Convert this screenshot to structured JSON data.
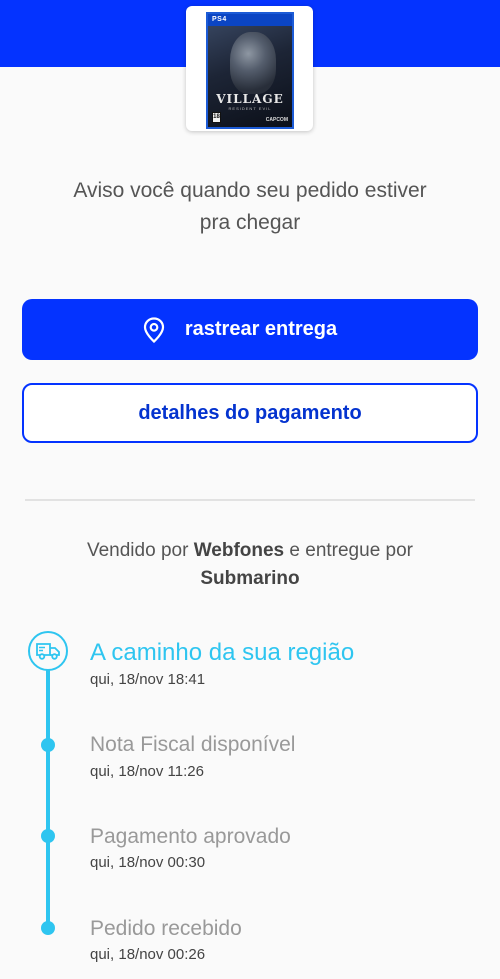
{
  "product": {
    "platform_label": "PS4",
    "game_logo": "VILLAGE",
    "game_logo_sub": "RESIDENT EVIL",
    "rating": "18",
    "publisher": "CAPCOM"
  },
  "notice": {
    "line1": "Aviso você quando seu pedido estiver",
    "line2": "pra chegar"
  },
  "actions": {
    "track_label": "rastrear entrega",
    "track_icon": "location-pin-icon",
    "payment_label": "detalhes do pagamento"
  },
  "seller": {
    "prefix": "Vendido por",
    "seller_name": "Webfones",
    "middle": "e entregue por",
    "carrier": "Submarino"
  },
  "timeline": {
    "active_icon": "delivery-truck-icon",
    "accent_color": "#2ec5f0",
    "steps": [
      {
        "title": "A caminho da sua região",
        "date": "qui, 18/nov 18:41"
      },
      {
        "title": "Nota Fiscal disponível",
        "date": "qui, 18/nov 11:26"
      },
      {
        "title": "Pagamento aprovado",
        "date": "qui, 18/nov 00:30"
      },
      {
        "title": "Pedido recebido",
        "date": "qui, 18/nov 00:26"
      }
    ]
  },
  "colors": {
    "brand_blue": "#0433ff",
    "timeline_cyan": "#2ec5f0"
  }
}
